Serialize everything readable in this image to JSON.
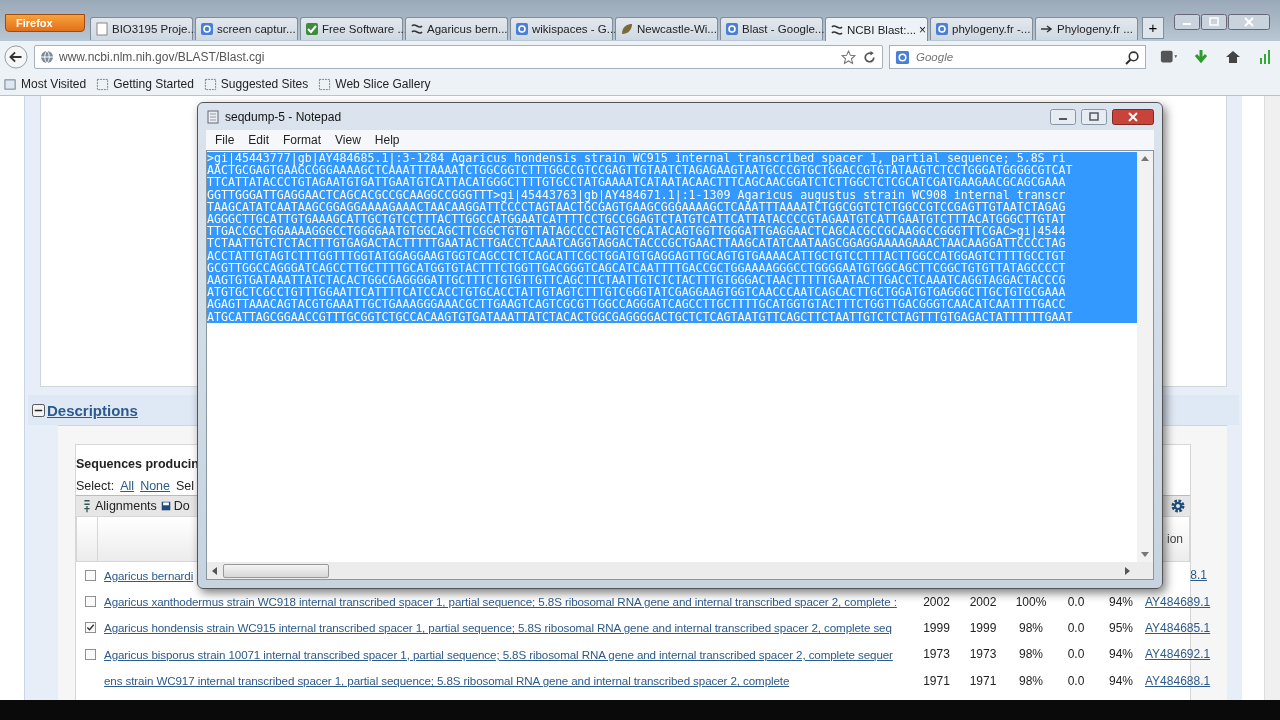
{
  "browser": {
    "app_button": "Firefox",
    "tabs": [
      {
        "label": "BIO3195 Proje...",
        "kind": "page",
        "selected": false
      },
      {
        "label": "screen captur...",
        "kind": "search",
        "selected": false
      },
      {
        "label": "Free Software ...",
        "kind": "check",
        "selected": false
      },
      {
        "label": "Agaricus bern...",
        "kind": "helix",
        "selected": false
      },
      {
        "label": "wikispaces - G...",
        "kind": "search",
        "selected": false
      },
      {
        "label": "Newcastle-Wi...",
        "kind": "leaf",
        "selected": false
      },
      {
        "label": "Blast - Google...",
        "kind": "search",
        "selected": false
      },
      {
        "label": "NCBI Blast:...",
        "kind": "helix",
        "selected": true
      },
      {
        "label": "phylogeny.fr -...",
        "kind": "search",
        "selected": false
      },
      {
        "label": "Phylogeny.fr ...",
        "kind": "arrow",
        "selected": false
      }
    ],
    "tab_close": "×",
    "new_tab": "+",
    "url": "www.ncbi.nlm.nih.gov/BLAST/Blast.cgi",
    "search_placeholder": "Google",
    "bookmarks": [
      "Most Visited",
      "Getting Started",
      "Suggested Sites",
      "Web Slice Gallery"
    ]
  },
  "page": {
    "section_title": "Descriptions",
    "expanded": true,
    "table_title": "Sequences producin",
    "select_label": "Select:",
    "select_links": [
      "All",
      "None"
    ],
    "select_tail": "Sel",
    "toolbar": [
      "Alignments",
      "Do"
    ],
    "header_tail": "ion",
    "rows": [
      {
        "description": "Agaricus bernardi",
        "checked": false,
        "accession": "8.1"
      },
      {
        "description": "Agaricus xanthodermus strain WC918 internal transcribed spacer 1, partial sequence; 5.8S ribosomal RNA gene and internal transcribed spacer 2, complete :",
        "checked": false,
        "max_score": "2002",
        "total_score": "2002",
        "query_cover": "100%",
        "e_value": "0.0",
        "ident": "94%",
        "accession": "AY484689.1"
      },
      {
        "description": "Agaricus hondensis strain WC915 internal transcribed spacer 1, partial sequence; 5.8S ribosomal RNA gene and internal transcribed spacer 2, complete seq",
        "checked": true,
        "max_score": "1999",
        "total_score": "1999",
        "query_cover": "98%",
        "e_value": "0.0",
        "ident": "95%",
        "accession": "AY484685.1"
      },
      {
        "description": "Agaricus bisporus strain 10071 internal transcribed spacer 1, partial sequence; 5.8S ribosomal RNA gene and internal transcribed spacer 2, complete sequer",
        "checked": false,
        "max_score": "1973",
        "total_score": "1973",
        "query_cover": "98%",
        "e_value": "0.0",
        "ident": "94%",
        "accession": "AY484692.1"
      },
      {
        "description": "ens strain WC917 internal transcribed spacer 1, partial sequence; 5.8S ribosomal RNA gene and internal transcribed spacer 2, complete",
        "max_score": "1971",
        "total_score": "1971",
        "query_cover": "98%",
        "e_value": "0.0",
        "ident": "94%",
        "accession": "AY484688.1"
      }
    ]
  },
  "notepad": {
    "title": "seqdump-5 - Notepad",
    "menu": [
      "File",
      "Edit",
      "Format",
      "View",
      "Help"
    ],
    "lines": [
      ">gi|45443777|gb|AY484685.1|:3-1284 Agaricus hondensis strain WC915 internal transcribed spacer 1, partial sequence; 5.8S ri",
      "AACTGCGAGTGAAGCGGGAAAAGCTCAAATTTAAAATCTGGCGGTCTTTGGCCGTCCGAGTTGTAATCTAGAGAAGTAATGCCCGTGCTGGACCGTGTATAAGTCTCCTGGGATGGGGCGTCAT",
      "TTCATTATACCCTGTAGAATGTGATTGAATGTCATTACATGGGCTTTTGTGCCTATGAAAATCATAATACAACTTTCAGCAACGGATCTCTTGGCTCTCGCATCGATGAAGAACGCAGCGAAA",
      "GGTTGGGATTGAGGAACTCAGCACGCCGCAAGGCCGGGTTT>gi|45443763|gb|AY484671.1|:1-1309 Agaricus augustus strain WC908 internal transcr",
      "TAAGCATATCAATAAGCGGAGGAAAAGAAACTAACAAGGATTCCCCTAGTAACTGCGAGTGAAGCGGGAAAAGCTCAAATTTAAAATCTGGCGGTCTCTGGCCGTCCGAGTTGTAATCTAGAG",
      "AGGGCTTGCATTGTGAAAGCATTGCTGTCCTTTACTTGGCCATGGAATCATTTTCCTGCCGGAGTCTATGTCATTCATTATACCCCGTAGAATGTCATTGAATGTCTTTACATGGGCTTGTAT",
      "TTGACCGCTGGAAAAGGGCCTGGGGAATGTGGCAGCTTCGGCTGTGTTATAGCCCCTAGTCGCATACAGTGGTTGGGATTGAGGAACTCAGCACGCCGCAAGGCCGGGTTTCGAC>gi|4544",
      "TCTAATTGTCTCTACTTTGTGAGACTACTTTTTGAATACTTGACCTCAAATCAGGTAGGACTACCCGCTGAACTTAAGCATATCAATAAGCGGAGGAAAAGAAACTAACAAGGATTCCCCTAG",
      "ACCTATTGTAGTCTTTGGTTTGGTATGGAGGAAGTGGTCAGCCTCTCAGCATTCGCTGGATGTGAGGAGTTGCAGTGTGAAAACATTGCTGTCCTTTACTTGGCCATGGAGTCTTTTGCCTGT",
      "GCGTTGGCCAGGGATCAGCCTTGCTTTTGCATGGTGTACTTTCTGGTTGACGGGTCAGCATCAATTTTGACCGCTGGAAAAGGGCCTGGGGAATGTGGCAGCTTCGGCTGTGTTATAGCCCCT",
      "AAGTGTGATAAATTATCTACACTGGCGAGGGGATTGCTTTCTGTGTTGTTCAGCTTCTAATTGTCTCTACTTTGTGGGACTAACTTTTTGAATACTTGACCTCAAATCAGGTAGGACTACCCG",
      "ATGTGCTCGCCTGTTTGGAATTCATTTTCATCCACCTGTGCACCTATTGTAGTCTTTGTCGGGTATCGAGGAAGTGGTCAACCCAATCAGCACTTGCTGGATGTGAGGGCTTGCTGTGCGAAA",
      "AGAGTTAAACAGTACGTGAAATTGCTGAAAGGGAAACGCTTGAAGTCAGTCGCGTTGGCCAGGGATCAGCCTTGCTTTTGCATGGTGTACTTTCTGGTTGACGGGTCAACATCAATTTTGACC",
      "ATGCATTAGCGGAACCGTTTGCGGTCTGCCACAAGTGTGATAAATTATCTACACTGGCGAGGGGACTGCTCTCAGTAATGTTCAGCTTCTAATTGTCTCTAGTTTGTGAGACTATTTTTTGAAT"
    ]
  }
}
